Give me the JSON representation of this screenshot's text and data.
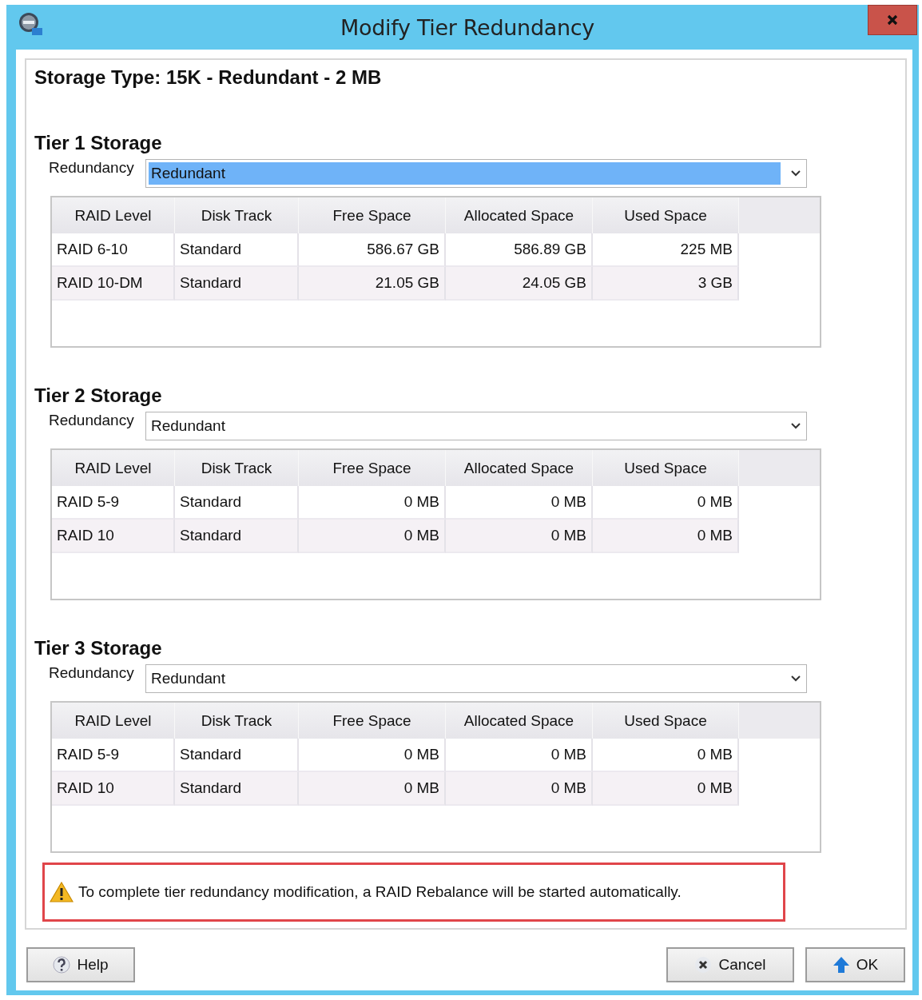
{
  "window": {
    "title": "Modify Tier Redundancy"
  },
  "storage_type": "Storage Type: 15K - Redundant - 2 MB",
  "tiers": [
    {
      "title": "Tier 1 Storage",
      "redundancy_label": "Redundancy",
      "redundancy": {
        "value": "Redundant",
        "focused": true
      },
      "columns": [
        "RAID Level",
        "Disk Track",
        "Free Space",
        "Allocated Space",
        "Used Space"
      ],
      "rows": [
        [
          "RAID 6-10",
          "Standard",
          "586.67 GB",
          "586.89 GB",
          "225 MB"
        ],
        [
          "RAID 10-DM",
          "Standard",
          "21.05 GB",
          "24.05 GB",
          "3 GB"
        ]
      ]
    },
    {
      "title": "Tier 2 Storage",
      "redundancy_label": "Redundancy",
      "redundancy": {
        "value": "Redundant",
        "focused": false
      },
      "columns": [
        "RAID Level",
        "Disk Track",
        "Free Space",
        "Allocated Space",
        "Used Space"
      ],
      "rows": [
        [
          "RAID 5-9",
          "Standard",
          "0 MB",
          "0 MB",
          "0 MB"
        ],
        [
          "RAID 10",
          "Standard",
          "0 MB",
          "0 MB",
          "0 MB"
        ]
      ]
    },
    {
      "title": "Tier 3 Storage",
      "redundancy_label": "Redundancy",
      "redundancy": {
        "value": "Redundant",
        "focused": false
      },
      "columns": [
        "RAID Level",
        "Disk Track",
        "Free Space",
        "Allocated Space",
        "Used Space"
      ],
      "rows": [
        [
          "RAID 5-9",
          "Standard",
          "0 MB",
          "0 MB",
          "0 MB"
        ],
        [
          "RAID 10",
          "Standard",
          "0 MB",
          "0 MB",
          "0 MB"
        ]
      ]
    }
  ],
  "warning": "To complete tier redundancy modification, a RAID Rebalance will be started automatically.",
  "buttons": [
    {
      "label": "Help",
      "kind": "help"
    },
    {
      "label": "Cancel",
      "kind": "cancel"
    },
    {
      "label": "OK",
      "kind": "ok"
    }
  ]
}
